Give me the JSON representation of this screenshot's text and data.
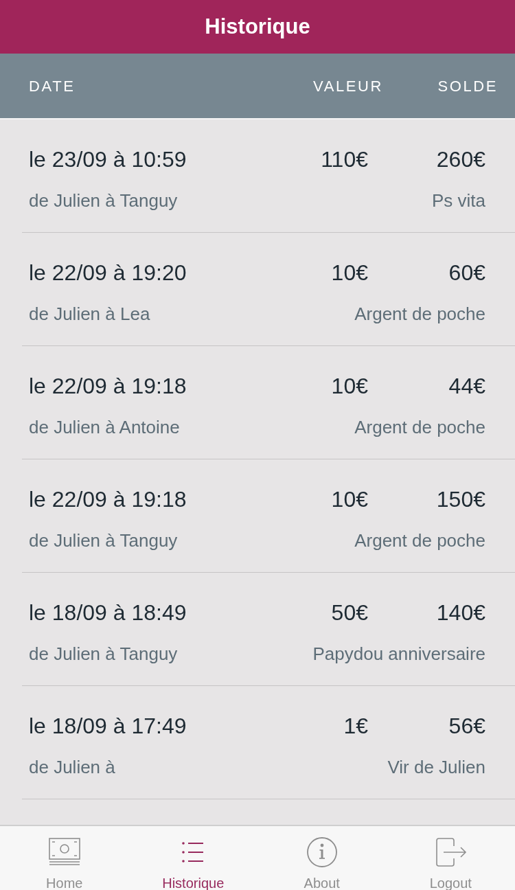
{
  "title": "Historique",
  "columns": [
    "DATE",
    "VALEUR",
    "SOLDE"
  ],
  "rows": [
    {
      "date": "le 23/09 à 10:59",
      "value": "110€",
      "balance": "260€",
      "parties": "de Julien à Tanguy",
      "note": "Ps vita"
    },
    {
      "date": "le 22/09 à 19:20",
      "value": "10€",
      "balance": "60€",
      "parties": "de Julien à Lea",
      "note": "Argent de poche"
    },
    {
      "date": "le 22/09 à 19:18",
      "value": "10€",
      "balance": "44€",
      "parties": "de Julien à Antoine",
      "note": "Argent de poche"
    },
    {
      "date": "le 22/09 à 19:18",
      "value": "10€",
      "balance": "150€",
      "parties": "de Julien à Tanguy",
      "note": "Argent de poche"
    },
    {
      "date": "le 18/09 à 18:49",
      "value": "50€",
      "balance": "140€",
      "parties": "de Julien à Tanguy",
      "note": "Papydou anniversaire"
    },
    {
      "date": "le 18/09 à 17:49",
      "value": "1€",
      "balance": "56€",
      "parties": "de Julien à",
      "note": "Vir de Julien"
    }
  ],
  "tabs": [
    {
      "label": "Home",
      "kind": "banknote",
      "selected": false
    },
    {
      "label": "Historique",
      "kind": "list",
      "selected": true
    },
    {
      "label": "About",
      "kind": "info",
      "selected": false
    },
    {
      "label": "Logout",
      "kind": "exit",
      "selected": false
    }
  ]
}
